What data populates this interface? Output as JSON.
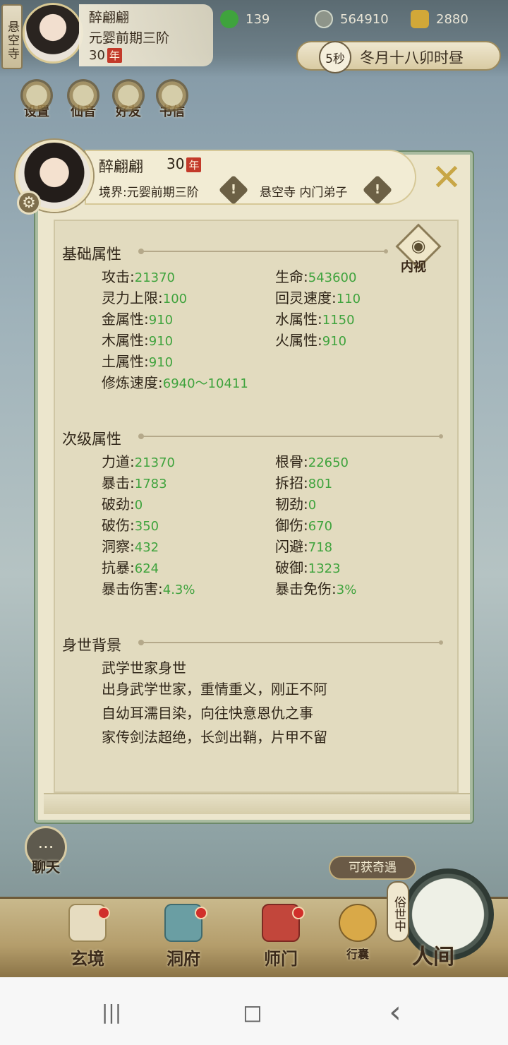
{
  "hud": {
    "sect_tag": "悬空寺",
    "name": "醉翩翩",
    "realm": "元婴前期三阶",
    "age": "30",
    "nian": "年",
    "resources": [
      {
        "icon": "jade-icon",
        "value": "139",
        "color": "#3fa33d"
      },
      {
        "icon": "coin-icon",
        "value": "564910",
        "color": "#cfd6c8"
      },
      {
        "icon": "gold-ingot-icon",
        "value": "2880",
        "color": "#d2a838"
      }
    ],
    "time_seconds": "5秒",
    "time_text": "冬月十八卯时昼",
    "buttons": [
      "设置",
      "仙音",
      "好友",
      "书信"
    ]
  },
  "dialog": {
    "name": "醉翩翩",
    "age": "30",
    "nian": "年",
    "realm_label": "境界:元婴前期三阶",
    "sect_label": "悬空寺 内门弟子",
    "close_glyph": "✕",
    "neishi_label": "内视",
    "basic": {
      "title": "基础属性",
      "stats": [
        {
          "label": "攻击",
          "value": "21370"
        },
        {
          "label": "生命",
          "value": "543600"
        },
        {
          "label": "灵力上限",
          "value": "100"
        },
        {
          "label": "回灵速度",
          "value": "110"
        },
        {
          "label": "金属性",
          "value": "910"
        },
        {
          "label": "水属性",
          "value": "1150"
        },
        {
          "label": "木属性",
          "value": "910"
        },
        {
          "label": "火属性",
          "value": "910"
        },
        {
          "label": "土属性",
          "value": "910"
        },
        {
          "label": "修炼速度",
          "value": "6940～10411"
        }
      ]
    },
    "secondary": {
      "title": "次级属性",
      "stats": [
        {
          "label": "力道",
          "value": "21370"
        },
        {
          "label": "根骨",
          "value": "22650"
        },
        {
          "label": "暴击",
          "value": "1783"
        },
        {
          "label": "拆招",
          "value": "801"
        },
        {
          "label": "破劲",
          "value": "0"
        },
        {
          "label": "韧劲",
          "value": "0"
        },
        {
          "label": "破伤",
          "value": "350"
        },
        {
          "label": "御伤",
          "value": "670"
        },
        {
          "label": "洞察",
          "value": "432"
        },
        {
          "label": "闪避",
          "value": "718"
        },
        {
          "label": "抗暴",
          "value": "624"
        },
        {
          "label": "破御",
          "value": "1323"
        },
        {
          "label": "暴击伤害",
          "value": "4.3%"
        },
        {
          "label": "暴击免伤",
          "value": "3%"
        }
      ]
    },
    "background": {
      "title": "身世背景",
      "lines": [
        "武学世家身世",
        "出身武学世家，重情重义，刚正不阿",
        "自幼耳濡目染，向往快意恩仇之事",
        "家传剑法超绝，长剑出鞘，片甲不留"
      ]
    }
  },
  "bottom": {
    "chat": "聊天",
    "qiyu": "可获奇遇",
    "sushi": "俗世中",
    "nav": [
      "玄境",
      "洞府",
      "师门",
      "行囊",
      "人间"
    ]
  },
  "system_nav": {
    "recents": "|||",
    "home": "◻",
    "back": "‹"
  }
}
